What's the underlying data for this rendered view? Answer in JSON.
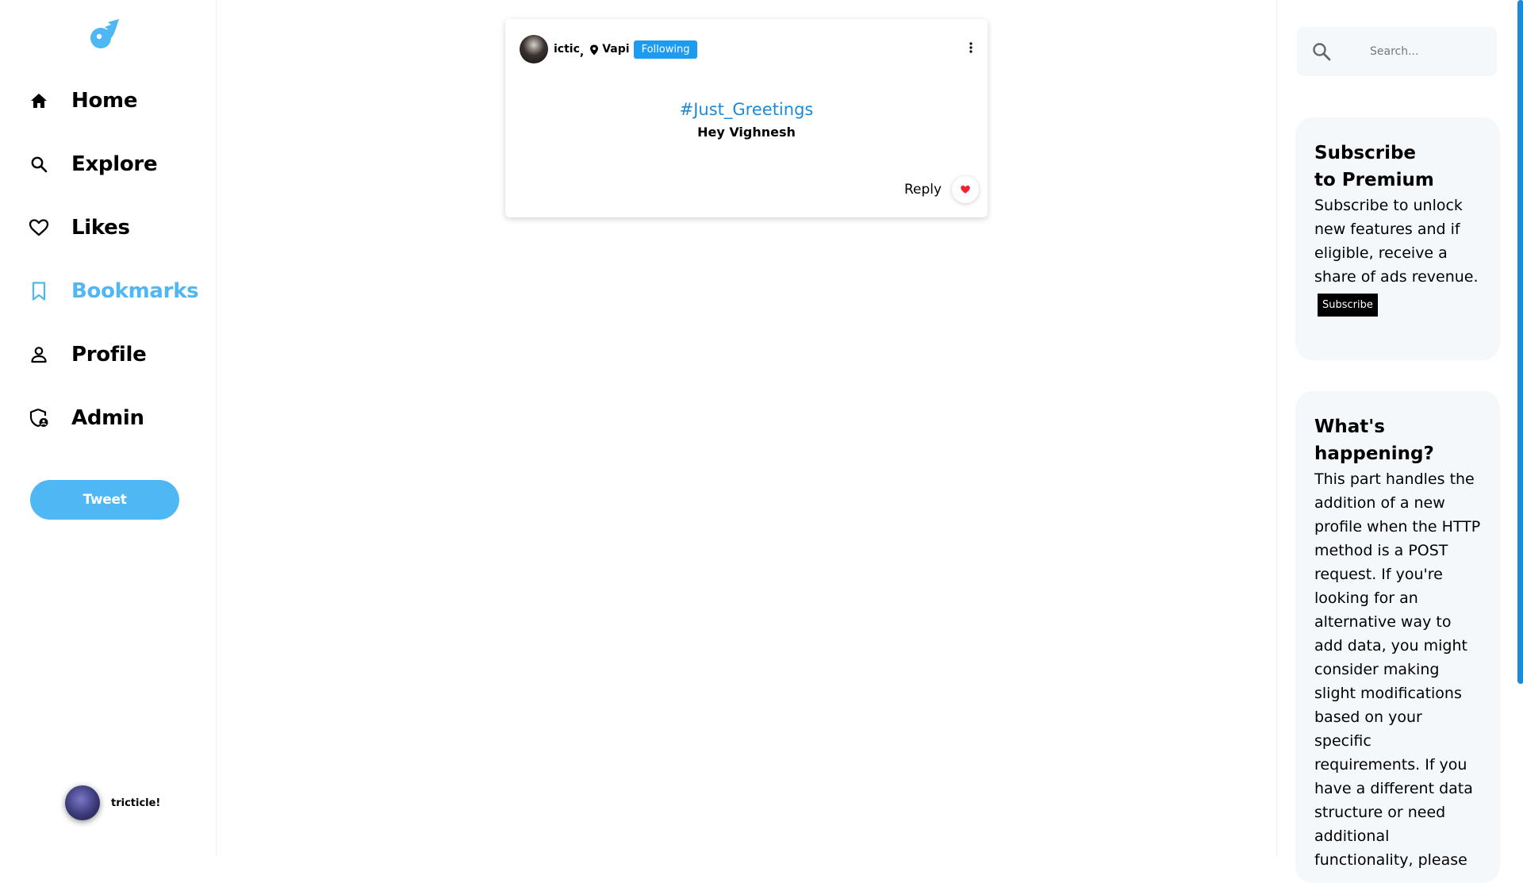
{
  "sidebar": {
    "items": [
      {
        "label": "Home",
        "icon": "home-icon"
      },
      {
        "label": "Explore",
        "icon": "search-icon"
      },
      {
        "label": "Likes",
        "icon": "heart-icon"
      },
      {
        "label": "Bookmarks",
        "icon": "bookmark-icon"
      },
      {
        "label": "Profile",
        "icon": "person-icon"
      },
      {
        "label": "Admin",
        "icon": "admin-shield-icon"
      }
    ],
    "active_item": "Bookmarks",
    "tweet_button": "Tweet",
    "user": {
      "name": "tricticle!"
    }
  },
  "post": {
    "author": "ictic",
    "comma": ",",
    "location": "Vapi",
    "follow_label": "Following",
    "hashtag": "#Just_Greetings",
    "text": "Hey Vighnesh",
    "reply_label": "Reply"
  },
  "right": {
    "search": {
      "placeholder": "Search..."
    },
    "premium": {
      "title": "Subscribe to Premium",
      "body": "Subscribe to unlock new features and if eligible, receive a share of ads revenue.",
      "button": "Subscribe"
    },
    "happening": {
      "title": "What's happening?",
      "body": "This part handles the addition of a new profile when the HTTP method is a POST request. If you're looking for an alternative way to add data, you might consider making slight modifications based on your specific requirements. If you have a different data structure or need additional functionality, please"
    }
  },
  "colors": {
    "accent": "#50b7f5",
    "following_badge": "#1d9bf0",
    "hashtag": "#1d8ad8",
    "like": "#f4212e",
    "panel_bg": "#f5f8fa"
  }
}
